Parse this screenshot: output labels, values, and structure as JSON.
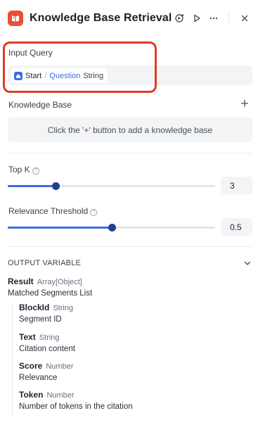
{
  "header": {
    "title": "Knowledge Base Retrieval",
    "accent_color": "#e8502f",
    "icons": [
      "knowledge-base-icon",
      "debug-icon",
      "run-icon",
      "more-icon",
      "close-icon"
    ]
  },
  "input_query": {
    "label": "Input Query",
    "variable": {
      "node": "Start",
      "separator": "/",
      "name": "Question",
      "type": "String"
    }
  },
  "knowledge_base": {
    "label": "Knowledge Base",
    "empty_text": "Click the '+' button to add a knowledge base"
  },
  "top_k": {
    "label": "Top K",
    "value": "3",
    "fill_fraction": 0.23
  },
  "relevance_threshold": {
    "label": "Relevance Threshold",
    "value": "0.5",
    "fill_fraction": 0.5
  },
  "output": {
    "title": "OUTPUT VARIABLE",
    "result": {
      "name": "Result",
      "type": "Array[Object]",
      "description": "Matched Segments List"
    },
    "fields": [
      {
        "name": "BlockId",
        "type": "String",
        "description": "Segment ID"
      },
      {
        "name": "Text",
        "type": "String",
        "description": "Citation content"
      },
      {
        "name": "Score",
        "type": "Number",
        "description": "Relevance"
      },
      {
        "name": "Token",
        "type": "Number",
        "description": "Number of tokens in the citation"
      }
    ]
  }
}
